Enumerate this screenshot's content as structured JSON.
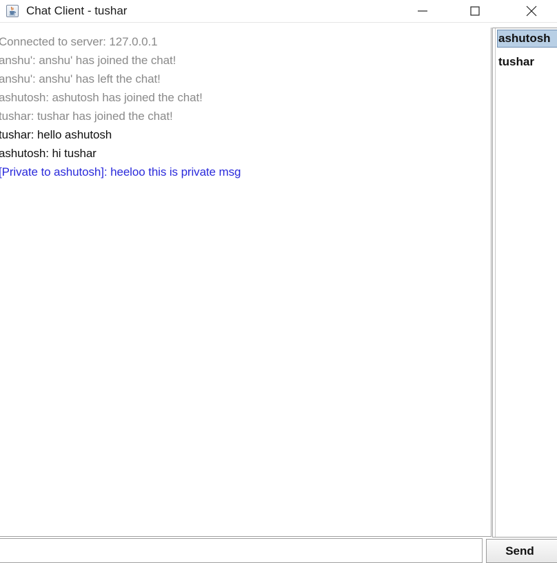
{
  "window": {
    "title": "Chat Client - tushar",
    "icon": "java-cup-icon"
  },
  "chat": {
    "messages": [
      {
        "text": "Connected to server: 127.0.0.1",
        "kind": "system"
      },
      {
        "text": "anshu': anshu' has joined the chat!",
        "kind": "system"
      },
      {
        "text": "anshu': anshu' has left the chat!",
        "kind": "system"
      },
      {
        "text": "ashutosh: ashutosh has joined the chat!",
        "kind": "system"
      },
      {
        "text": "tushar: tushar has joined the chat!",
        "kind": "system"
      },
      {
        "text": "tushar: hello ashutosh",
        "kind": "chat"
      },
      {
        "text": "ashutosh: hi tushar",
        "kind": "chat"
      },
      {
        "text": "[Private to ashutosh]: heeloo this is private msg",
        "kind": "private"
      }
    ]
  },
  "users": {
    "items": [
      {
        "name": "ashutosh",
        "selected": true
      },
      {
        "name": "tushar",
        "selected": false
      }
    ]
  },
  "input": {
    "value": "",
    "placeholder": ""
  },
  "send": {
    "label": "Send"
  },
  "colors": {
    "system_text": "#8a8a8a",
    "chat_text": "#111111",
    "private_text": "#2a2adb",
    "selection": "#b8cfe5"
  }
}
